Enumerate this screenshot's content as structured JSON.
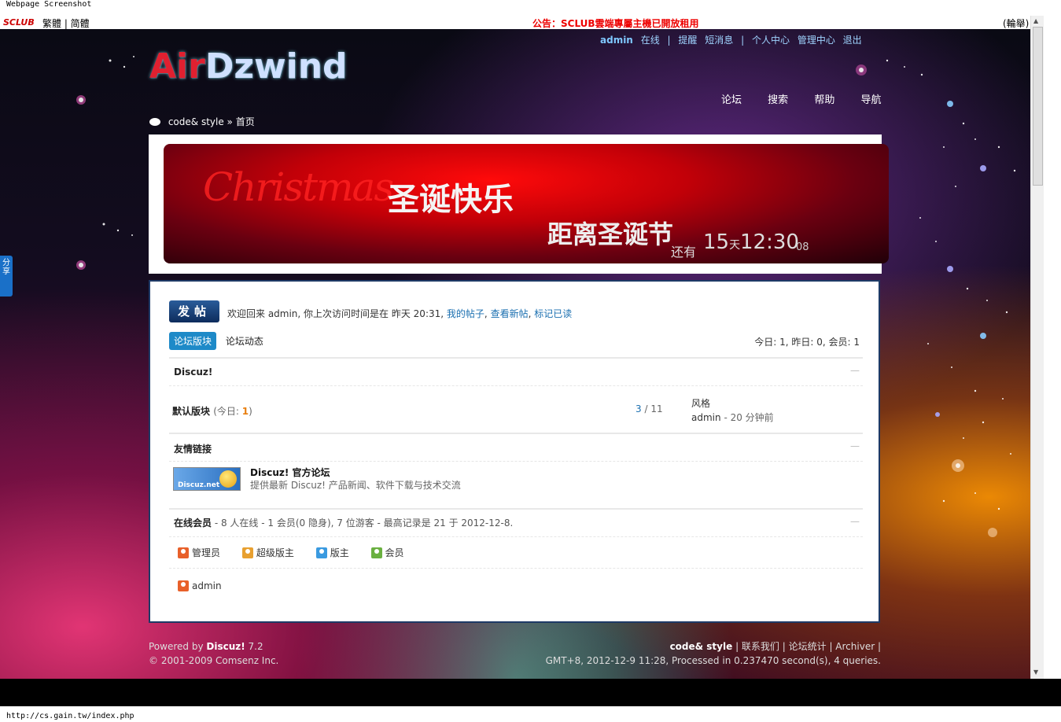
{
  "captions": {
    "top": "Webpage Screenshot",
    "bottom": "http://cs.gain.tw/index.php"
  },
  "topbar": {
    "brand": "SCLUB",
    "lang": "繁體 | 简體",
    "notice": "公告：SCLUB雲端專屬主機已開放租用",
    "right": "(輪舉)"
  },
  "share_label": "分享",
  "logo": {
    "red": "Air",
    "rest": "Dzwind"
  },
  "user_links": {
    "username": "admin",
    "items": [
      "在线",
      "|",
      "提醒",
      "短消息",
      "|",
      "个人中心",
      "管理中心",
      "退出"
    ]
  },
  "main_nav": [
    "论坛",
    "搜索",
    "帮助",
    "导航"
  ],
  "breadcrumb": {
    "site": "code& style",
    "sep": "»",
    "current": "首页"
  },
  "banner": {
    "xmas": "Christmas",
    "greeting": "圣诞快乐",
    "countdown_title": "距离圣诞节",
    "remaining": "还有",
    "days": "15",
    "days_unit": "天",
    "time": "12:30",
    "seconds": "08"
  },
  "post_button": "发帖",
  "welcome": {
    "text": "欢迎回来 admin, 你上次访问时间是在 昨天 20:31,",
    "links": [
      "我的帖子",
      "查看新帖",
      "标记已读"
    ]
  },
  "tabs": {
    "active": "论坛版块",
    "other": "论坛动态"
  },
  "stats": "今日: 1, 昨日: 0, 会员: 1",
  "section_discuz": "Discuz!",
  "forum": {
    "name": "默认版块",
    "today_prefix": "(今日: ",
    "today_count": "1",
    "today_suffix": ")",
    "threads": "3",
    "posts": "11",
    "last_title": "风格",
    "last_user": "admin",
    "last_time": "- 20 分钟前"
  },
  "section_links": "友情链接",
  "friend_link": {
    "logo_text": "Discuz.net",
    "title": "Discuz! 官方论坛",
    "desc": "提供最新 Discuz! 产品新闻、软件下载与技术交流"
  },
  "online": {
    "label": "在线会员",
    "text": " - 8 人在线 - 1 会员(0 隐身), 7 位游客 - 最高记录是 21 于 2012-12-8."
  },
  "legend": [
    "管理员",
    "超级版主",
    "版主",
    "会员"
  ],
  "online_user": "admin",
  "collapse_glyph": "—",
  "footer": {
    "powered_prefix": "Powered by ",
    "powered_name": "Discuz!",
    "powered_ver": " 7.2",
    "copyright": "© 2001-2009 Comsenz Inc.",
    "site": "code& style",
    "links": [
      "联系我们",
      "论坛统计",
      "Archiver"
    ],
    "processed": "GMT+8, 2012-12-9 11:28, Processed in 0.237470 second(s), 4 queries."
  }
}
